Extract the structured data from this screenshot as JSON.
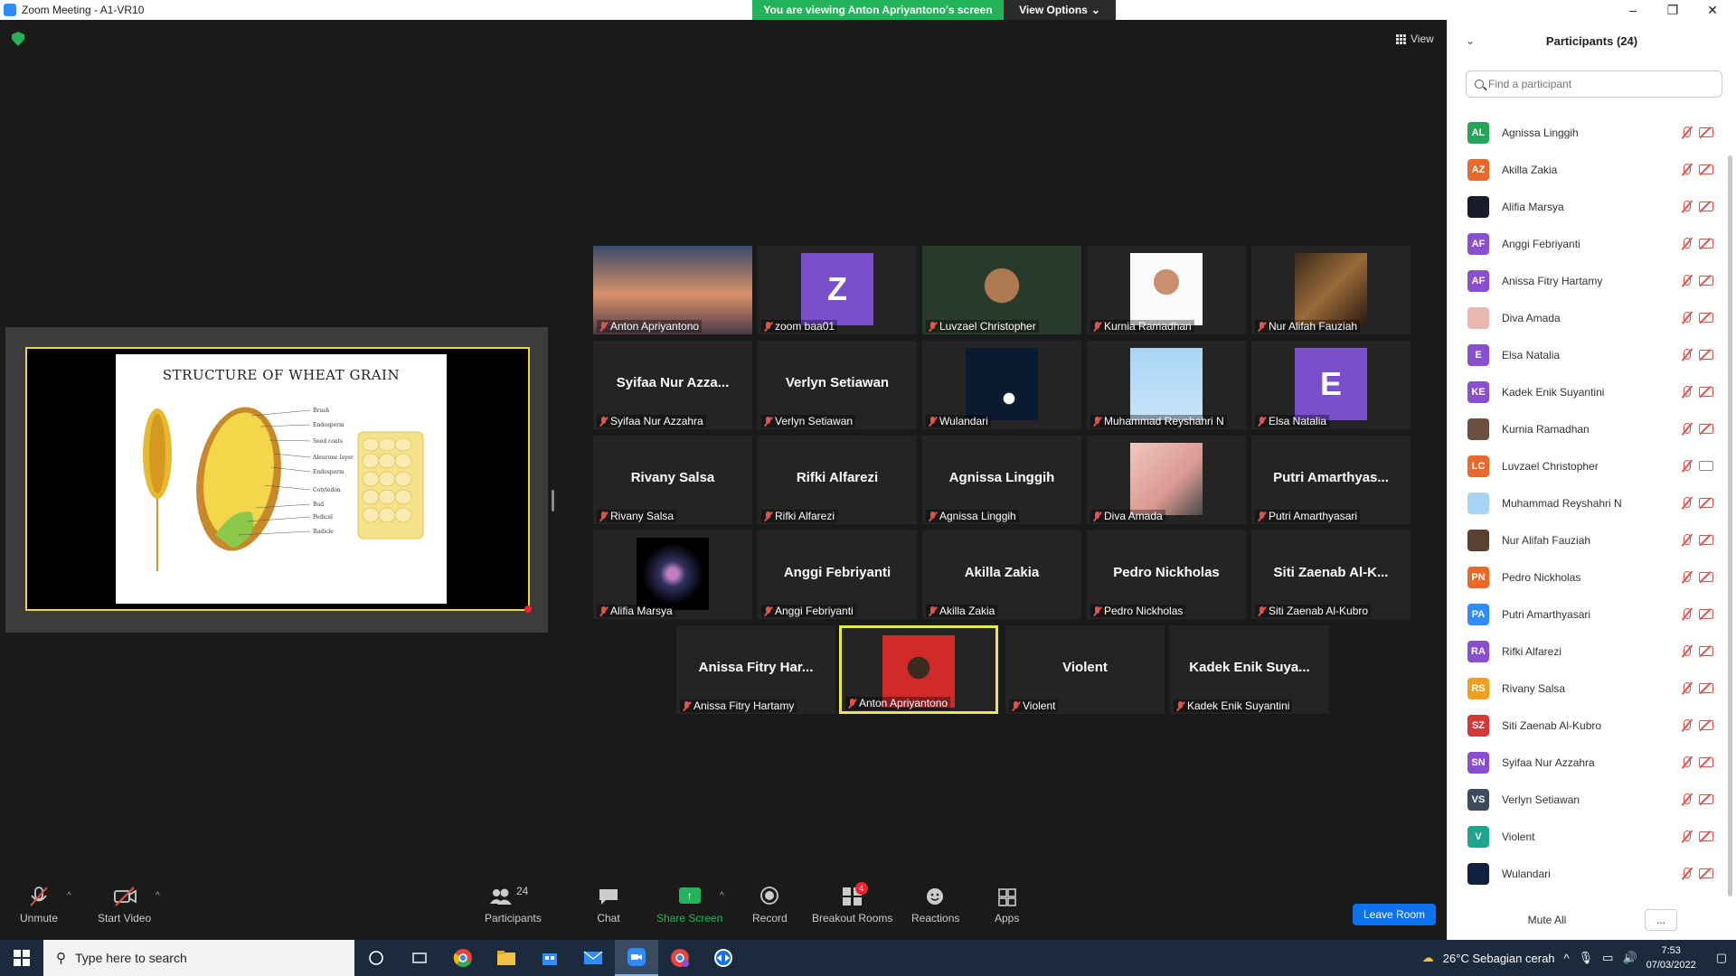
{
  "window": {
    "title": "Zoom Meeting - A1-VR10",
    "banner": "You are viewing Anton Apriyantono's screen",
    "view_options": "View Options",
    "view_label": "View"
  },
  "shared_screen": {
    "slide_title": "STRUCTURE OF WHEAT GRAIN",
    "labels": [
      "Brush",
      "Endosperm",
      "Seed coats",
      "Aleurone layer",
      "Endosperm",
      "Cotyledon",
      "Bud",
      "Pedicel",
      "Radicle"
    ]
  },
  "tiles": [
    {
      "name": "",
      "label": "Anton Apriyantono",
      "thumb": "photo-sky"
    },
    {
      "name": "",
      "label": "zoom baa01",
      "thumb": "avatar",
      "initial": "Z",
      "color": "#7a4fcc"
    },
    {
      "name": "",
      "label": "Luvzael Christopher",
      "thumb": "photo-person"
    },
    {
      "name": "",
      "label": "Kurnia Ramadhan",
      "thumb": "photo-person2"
    },
    {
      "name": "",
      "label": "Nur Alifah Fauziah",
      "thumb": "photo-dark"
    },
    {
      "name": "Syifaa Nur Azza...",
      "label": "Syifaa Nur Azzahra"
    },
    {
      "name": "Verlyn Setiawan",
      "label": "Verlyn Setiawan"
    },
    {
      "name": "",
      "label": "Wulandari",
      "thumb": "photo-moon"
    },
    {
      "name": "",
      "label": "Muhammad Reyshahri N",
      "thumb": "photo-sky2"
    },
    {
      "name": "",
      "label": "Elsa Natalia",
      "thumb": "avatar",
      "initial": "E",
      "color": "#7a4fcc"
    },
    {
      "name": "Rivany Salsa",
      "label": "Rivany Salsa"
    },
    {
      "name": "Rifki Alfarezi",
      "label": "Rifki Alfarezi"
    },
    {
      "name": "Agnissa Linggih",
      "label": "Agnissa Linggih"
    },
    {
      "name": "",
      "label": "Diva Amada",
      "thumb": "photo-pink"
    },
    {
      "name": "Putri Amarthyas...",
      "label": "Putri Amarthyasari"
    },
    {
      "name": "",
      "label": "Alifia Marsya",
      "thumb": "photo-galaxy"
    },
    {
      "name": "Anggi Febriyanti",
      "label": "Anggi Febriyanti"
    },
    {
      "name": "Akilla Zakia",
      "label": "Akilla Zakia"
    },
    {
      "name": "Pedro Nickholas",
      "label": "Pedro Nickholas"
    },
    {
      "name": "Siti Zaenab Al-K...",
      "label": "Siti Zaenab Al-Kubro"
    },
    {
      "name": "Anissa Fitry Har...",
      "label": "Anissa Fitry Hartamy"
    },
    {
      "name": "",
      "label": "Anton Apriyantono",
      "thumb": "photo-red",
      "active": true
    },
    {
      "name": "Violent",
      "label": "Violent"
    },
    {
      "name": "Kadek Enik Suya...",
      "label": "Kadek Enik Suyantini"
    }
  ],
  "toolbar": {
    "unmute": "Unmute",
    "start_video": "Start Video",
    "participants": "Participants",
    "participants_count": "24",
    "chat": "Chat",
    "share_screen": "Share Screen",
    "record": "Record",
    "breakout_rooms": "Breakout Rooms",
    "breakout_badge": "4",
    "reactions": "Reactions",
    "apps": "Apps",
    "leave": "Leave Room"
  },
  "panel": {
    "title": "Participants (24)",
    "search_placeholder": "Find a participant",
    "mute_all": "Mute All",
    "more": "...",
    "participants": [
      {
        "initials": "AL",
        "name": "Agnissa Linggih",
        "color": "#23a55a"
      },
      {
        "initials": "AZ",
        "name": "Akilla Zakia",
        "color": "#e8692a"
      },
      {
        "initials": "",
        "name": "Alifia Marsya",
        "color": "#1b1b2e"
      },
      {
        "initials": "AF",
        "name": "Anggi Febriyanti",
        "color": "#8a4fd0"
      },
      {
        "initials": "AF",
        "name": "Anissa Fitry Hartamy",
        "color": "#8a4fd0"
      },
      {
        "initials": "",
        "name": "Diva Amada",
        "color": "#e8b8b0"
      },
      {
        "initials": "E",
        "name": "Elsa Natalia",
        "color": "#8a4fd0"
      },
      {
        "initials": "KE",
        "name": "Kadek Enik Suyantini",
        "color": "#8a4fd0"
      },
      {
        "initials": "",
        "name": "Kurnia Ramadhan",
        "color": "#6b5040"
      },
      {
        "initials": "LC",
        "name": "Luvzael Christopher",
        "color": "#e8692a",
        "camera_on": true
      },
      {
        "initials": "",
        "name": "Muhammad Reyshahri N",
        "color": "#a8d4f4"
      },
      {
        "initials": "",
        "name": "Nur Alifah Fauziah",
        "color": "#5a4030"
      },
      {
        "initials": "PN",
        "name": "Pedro Nickholas",
        "color": "#e8692a"
      },
      {
        "initials": "PA",
        "name": "Putri Amarthyasari",
        "color": "#2d8cff"
      },
      {
        "initials": "RA",
        "name": "Rifki Alfarezi",
        "color": "#8a4fd0"
      },
      {
        "initials": "RS",
        "name": "Rivany Salsa",
        "color": "#f0a020"
      },
      {
        "initials": "SZ",
        "name": "Siti Zaenab Al-Kubro",
        "color": "#d23a3a"
      },
      {
        "initials": "SN",
        "name": "Syifaa Nur Azzahra",
        "color": "#8a4fd0"
      },
      {
        "initials": "VS",
        "name": "Verlyn Setiawan",
        "color": "#3c4a5c"
      },
      {
        "initials": "V",
        "name": "Violent",
        "color": "#1ea58c"
      },
      {
        "initials": "",
        "name": "Wulandari",
        "color": "#102040"
      }
    ]
  },
  "taskbar": {
    "search_placeholder": "Type here to search",
    "weather": "26°C  Sebagian cerah",
    "time": "7:53",
    "date": "07/03/2022"
  }
}
